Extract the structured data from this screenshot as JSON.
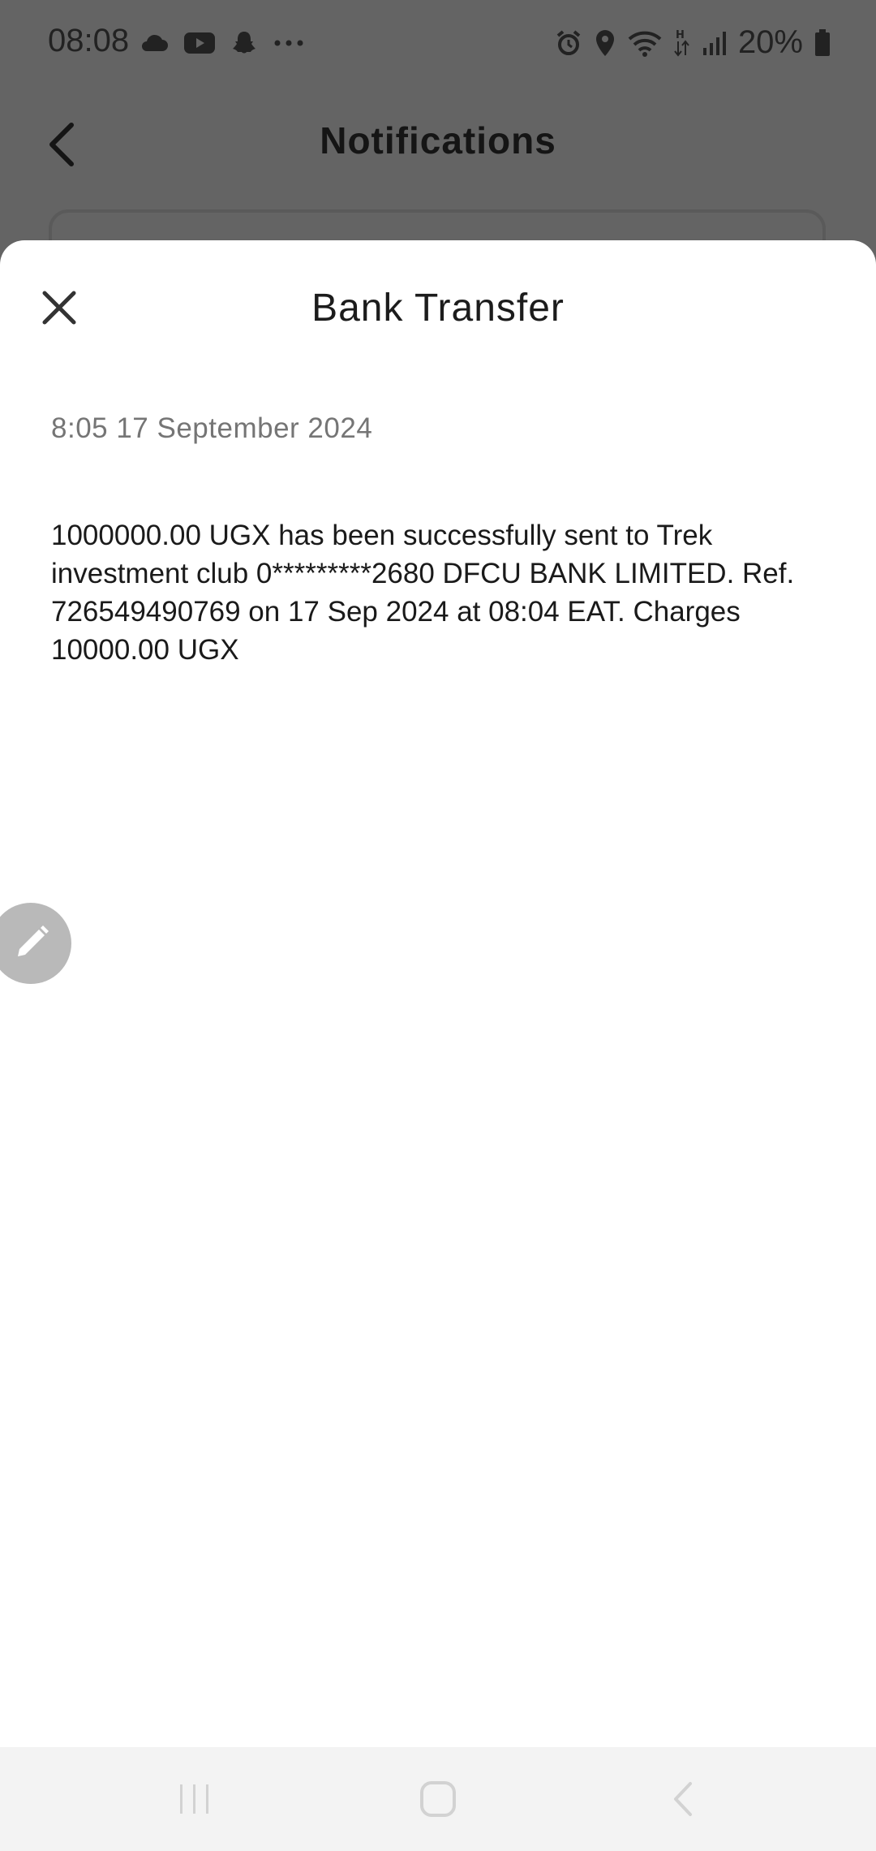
{
  "status_bar": {
    "time": "08:08",
    "battery": "20%",
    "icons_left": [
      "cloud-icon",
      "youtube-icon",
      "snapchat-icon",
      "more-icon"
    ],
    "icons_right": [
      "alarm-icon",
      "location-icon",
      "wifi-icon",
      "data-arrows-icon",
      "signal-icon",
      "battery-icon"
    ]
  },
  "background_screen": {
    "title": "Notifications"
  },
  "sheet": {
    "title": "Bank Transfer",
    "date": "8:05 17 September 2024",
    "message": "1000000.00 UGX has been successfully sent to Trek investment club 0*********2680 DFCU BANK LIMITED. Ref. 726549490769 on 17 Sep 2024 at 08:04 EAT. Charges 10000.00 UGX"
  },
  "colors": {
    "overlay": "#646464",
    "sheet_bg": "#ffffff",
    "fab": "#b9b9b9",
    "nav_bg": "#f3f3f3"
  }
}
